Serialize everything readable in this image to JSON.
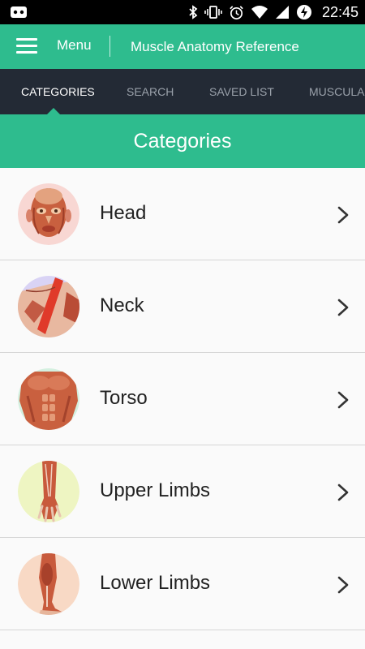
{
  "status_bar": {
    "time": "22:45",
    "icons": [
      "android-debug-icon",
      "bluetooth-icon",
      "vibrate-icon",
      "alarm-icon",
      "wifi-icon",
      "signal-icon",
      "battery-charging-icon"
    ]
  },
  "app_bar": {
    "menu_label": "Menu",
    "title": "Muscle Anatomy Reference"
  },
  "tabs": [
    {
      "label": "CATEGORIES",
      "active": true
    },
    {
      "label": "SEARCH",
      "active": false
    },
    {
      "label": "SAVED LIST",
      "active": false
    },
    {
      "label": "MUSCULAR",
      "active": false
    }
  ],
  "section": {
    "title": "Categories"
  },
  "categories": [
    {
      "label": "Head",
      "image": "head-muscles-image",
      "bg": "#f8d7d3"
    },
    {
      "label": "Neck",
      "image": "neck-muscles-image",
      "bg": "#d9d3f5"
    },
    {
      "label": "Torso",
      "image": "torso-muscles-image",
      "bg": "#d4f0e0"
    },
    {
      "label": "Upper Limbs",
      "image": "upper-limbs-muscles-image",
      "bg": "#eef5c2"
    },
    {
      "label": "Lower Limbs",
      "image": "lower-limbs-muscles-image",
      "bg": "#f8d9c5"
    }
  ],
  "colors": {
    "accent": "#2ebc8e",
    "tab_bar": "#232a35",
    "muscle": "#c85a3c"
  }
}
